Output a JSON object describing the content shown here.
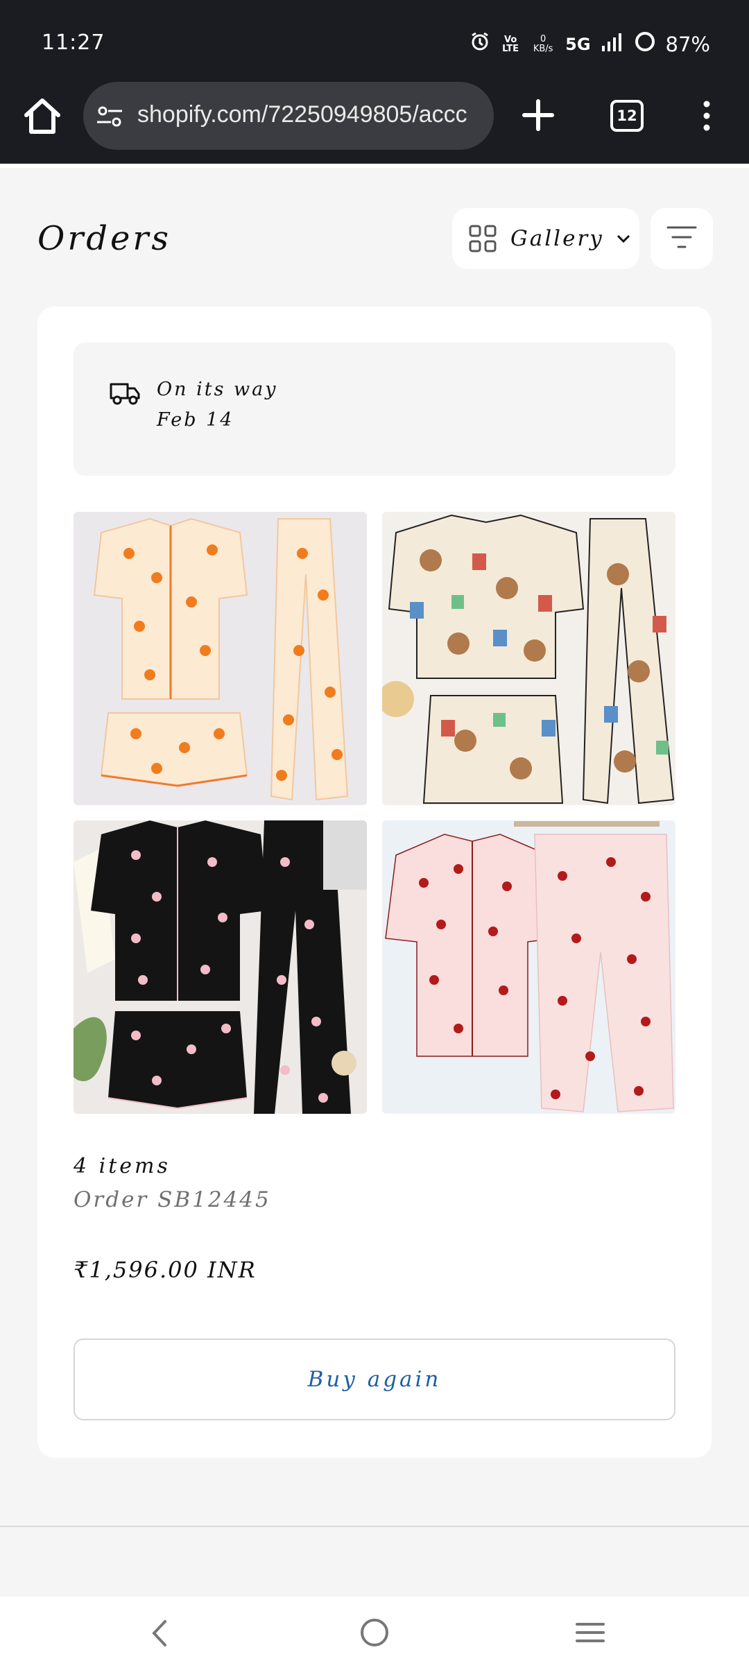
{
  "status_bar": {
    "time": "11:27",
    "net_label": "Vo LTE",
    "data_rate": "0 KB/s",
    "network": "5G",
    "battery": "87%"
  },
  "browser": {
    "url": "shopify.com/72250949805/accc",
    "tab_count": "12"
  },
  "page": {
    "title": "Orders",
    "view_selector": "Gallery"
  },
  "order": {
    "status": "On its way",
    "date": "Feb 14",
    "items_count": "4 items",
    "order_number": "Order SB12445",
    "total": "₹1,596.00 INR",
    "buy_again_label": "Buy again",
    "images": [
      {
        "name": "Orange print pajama set",
        "colors": [
          "#fbe9d2",
          "#f07c1e"
        ]
      },
      {
        "name": "Teddy bear alphabet pajama set",
        "colors": [
          "#f4ead9",
          "#b07a4c"
        ]
      },
      {
        "name": "Black heart pajama set",
        "colors": [
          "#141414",
          "#f3bcc8"
        ]
      },
      {
        "name": "Pink heart pajama set",
        "colors": [
          "#f9dcdc",
          "#b31a1a"
        ]
      }
    ]
  },
  "colors": {
    "status_bar_bg": "#1a1c22",
    "page_bg": "#f5f5f5",
    "link_blue": "#1d5fa8"
  }
}
